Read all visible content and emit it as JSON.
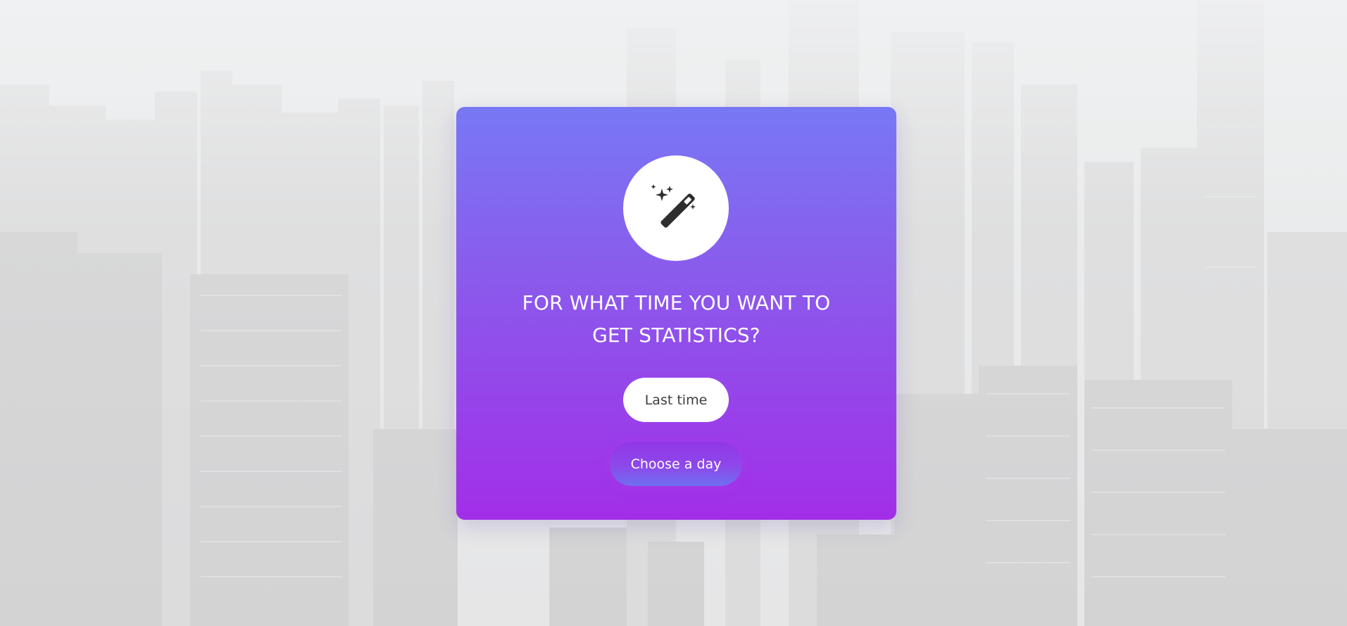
{
  "background": {
    "description_color": "#e9eaeb"
  },
  "dialog": {
    "icon": "magic-wand-icon",
    "title_line1": "FOR WHAT TIME YOU WANT TO",
    "title_line2": "GET STATISTICS?",
    "buttons": {
      "last_time": "Last time",
      "choose_day": "Choose a day"
    }
  },
  "colors": {
    "card_top": "#7878f5",
    "card_bottom": "#a22ee8",
    "button_white": "#ffffff",
    "text_dark": "#3d3d3d"
  }
}
